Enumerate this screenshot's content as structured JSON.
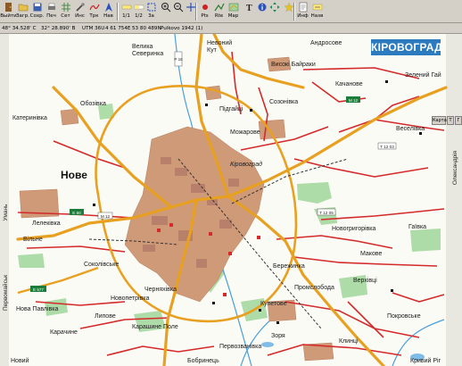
{
  "toolbar": {
    "buttons": [
      {
        "id": "exit",
        "label": "Выйти",
        "icon": "door-exit-icon"
      },
      {
        "id": "load",
        "label": "Загр.",
        "icon": "folder-open-icon"
      },
      {
        "id": "save",
        "label": "Сохр.",
        "icon": "floppy-disk-icon"
      },
      {
        "id": "print",
        "label": "Печ",
        "icon": "printer-icon"
      },
      {
        "id": "grid",
        "label": "Сет",
        "icon": "grid-icon"
      },
      {
        "id": "tools",
        "label": "Инс",
        "icon": "tools-icon"
      },
      {
        "id": "trk",
        "label": "Трк",
        "icon": "track-icon"
      },
      {
        "id": "nav",
        "label": "Нав",
        "icon": "navigation-icon"
      },
      {
        "id": "n1",
        "label": "1/1",
        "icon": "scale-icon"
      },
      {
        "id": "s1",
        "label": "1/2",
        "icon": "scale-half-icon"
      },
      {
        "id": "s2",
        "label": "3а",
        "icon": "zoom-area-icon"
      },
      {
        "id": "s3",
        "label": "",
        "icon": "zoom-in-icon"
      },
      {
        "id": "s4",
        "label": "",
        "icon": "zoom-out-icon"
      },
      {
        "id": "s5",
        "label": "",
        "icon": "pan-icon"
      },
      {
        "id": "pts",
        "label": "Pts",
        "icon": "waypoint-icon"
      },
      {
        "id": "rte",
        "label": "Rte",
        "icon": "route-icon"
      },
      {
        "id": "map",
        "label": "Map",
        "icon": "map-icon"
      },
      {
        "id": "txt",
        "label": "",
        "icon": "text-icon"
      },
      {
        "id": "info",
        "label": "",
        "icon": "info-icon"
      },
      {
        "id": "arrows",
        "label": "",
        "icon": "move-arrows-icon"
      },
      {
        "id": "star",
        "label": "",
        "icon": "star-icon"
      },
      {
        "id": "inf",
        "label": "Инф",
        "icon": "document-info-icon"
      },
      {
        "id": "back",
        "label": "Назв",
        "icon": "label-icon"
      }
    ]
  },
  "status": {
    "lat": "48° 34.528' С",
    "lon": "32° 28.890' В",
    "utm": "UTM  36U",
    "east": "4 61 754E",
    "north": "53 80 489N",
    "datum": "Pulkovo 1942 (1)"
  },
  "map": {
    "title": "КІРОВОГРАД",
    "controls": [
      "Карта",
      "Т",
      "Г"
    ],
    "big_labels": {
      "nove": "Нове"
    },
    "places": {
      "velyka_severynka": "Велика\nСеверинка",
      "nevodnyi": "Невоний\nКут",
      "andrusove": "Андросове",
      "vysoki_bairaky": "Високі Байраки",
      "kachanivka": "Качанове",
      "zelenyi_gai": "Зелений Гай",
      "obozivka": "Обозівка",
      "kateryn": "Катеринівка",
      "podgaitsi": "Підгайці",
      "sozonivka": "Созонівка",
      "veselivka": "Веселівка",
      "mozharove": "Можарове",
      "kirovograd": "Кіровоград",
      "lelekivka": "Лелеківка",
      "vilne": "Вільне",
      "novohryhorivka": "Новогригорівка",
      "haivka": "Гаївка",
      "makove": "Макове",
      "berezhynka": "Бережинка",
      "verkhivtsi": "Верхівці",
      "sokolivske": "Соколівське",
      "nova_pavlivka": "Нова Павлівка",
      "nechaivka": "Черняхівка",
      "novopetrivka": "Новопетрівка",
      "promsloboda": "Промслобода",
      "lypove": "Липове",
      "pokrovske": "Покровське",
      "klyntsi": "Клинці",
      "zorya": "Зоря",
      "pervozvanivka": "Первозванівка",
      "karachyne": "Карачине",
      "karashnoe_pole": "Карашине Поле",
      "bobrynets": "Бобринець",
      "kryvyi_rih": "Кривий Ріг",
      "novyi_bug": "Новий",
      "uman": "Умань",
      "pervomaisk": "Первомайськ",
      "oleksandriya": "Олександрія",
      "kupetovsk": "Купетове"
    },
    "roads": {
      "e50": "E 50",
      "e577": "E 577",
      "m12_w": "M 12",
      "m12_n": "M 12",
      "t1203": "T 12 03",
      "t1205": "T 12 05",
      "p": "P 16"
    },
    "colors": {
      "road_major": "#e8a020",
      "road_red": "#d42a2a",
      "water": "#4a9fd8",
      "forest": "#8ccf8c",
      "urban": "#c98e6a",
      "title_banner": "#2c7bbf"
    }
  }
}
